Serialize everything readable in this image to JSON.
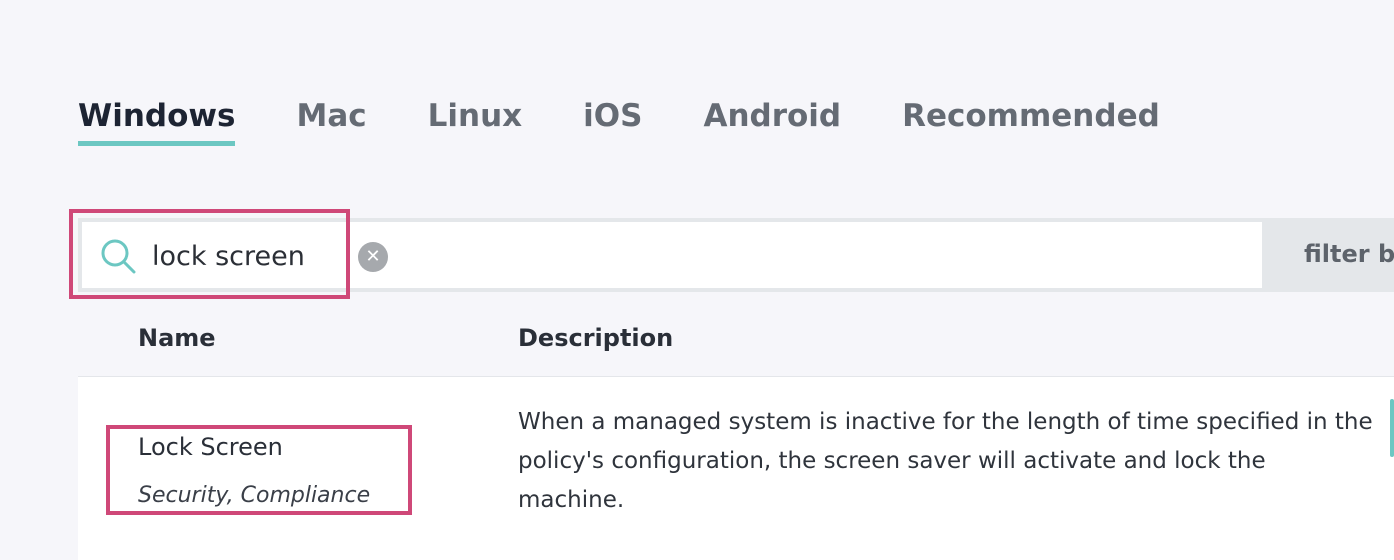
{
  "tabs": [
    {
      "label": "Windows",
      "active": true
    },
    {
      "label": "Mac",
      "active": false
    },
    {
      "label": "Linux",
      "active": false
    },
    {
      "label": "iOS",
      "active": false
    },
    {
      "label": "Android",
      "active": false
    },
    {
      "label": "Recommended",
      "active": false
    }
  ],
  "search": {
    "value": "lock screen",
    "icon": "search-icon",
    "clear_icon": "clear-icon"
  },
  "filter": {
    "label": "filter by"
  },
  "table": {
    "columns": [
      "Name",
      "Description"
    ],
    "rows": [
      {
        "name": "Lock Screen",
        "tags": "Security, Compliance",
        "description": "When a managed system is inactive for the length of time specified in the policy's configuration, the screen saver will activate and lock the machine."
      }
    ]
  },
  "colors": {
    "accent": "#6cc7c2",
    "highlight": "#cf4878",
    "background": "#f6f6fa"
  }
}
